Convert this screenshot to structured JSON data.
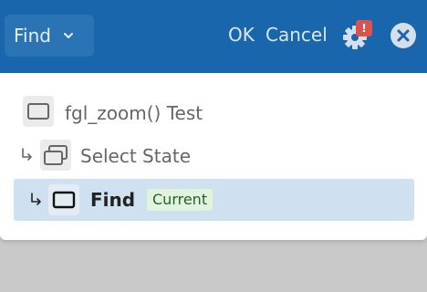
{
  "header": {
    "find_label": "Find",
    "ok_label": "OK",
    "cancel_label": "Cancel",
    "settings_badge": "!",
    "icons": {
      "dropdown": "chevron-down-icon",
      "settings": "gear-icon",
      "close": "close-circle-icon"
    }
  },
  "windows": {
    "items": [
      {
        "label": "fgl_zoom() Test",
        "icon": "window-icon"
      },
      {
        "label": "Select State",
        "icon": "stacked-windows-icon"
      },
      {
        "label": "Find",
        "icon": "window-icon",
        "tag": "Current"
      }
    ]
  },
  "colors": {
    "topbar": "#1a66ad",
    "selected_row": "#cfe0f1",
    "current_tag": "#dff3dd",
    "badge": "#d9534f"
  }
}
